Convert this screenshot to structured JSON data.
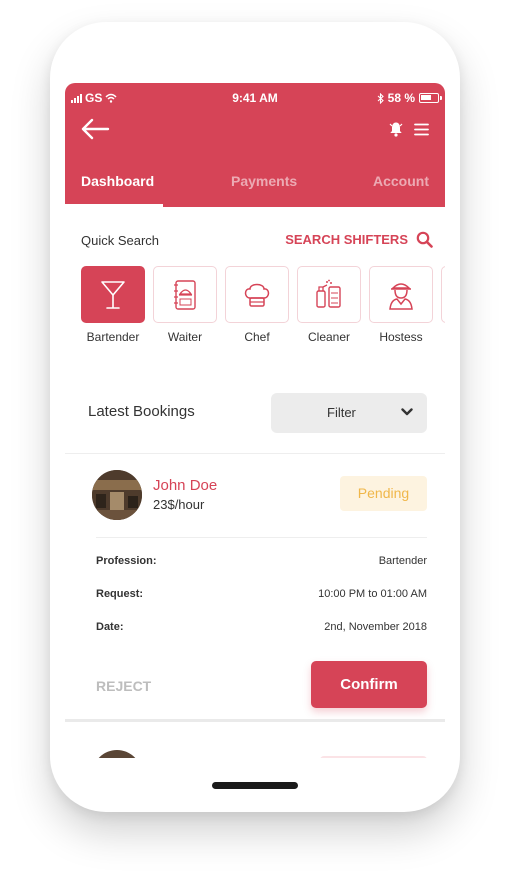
{
  "status_bar": {
    "carrier": "GS",
    "time": "9:41 AM",
    "battery": "58 %"
  },
  "header": {
    "tabs": [
      {
        "label": "Dashboard",
        "active": true
      },
      {
        "label": "Payments",
        "active": false
      },
      {
        "label": "Account",
        "active": false
      }
    ],
    "icons": [
      "back-arrow-icon",
      "bell-icon",
      "menu-icon"
    ]
  },
  "quick_search": {
    "label": "Quick Search",
    "link_label": "SEARCH SHIFTERS",
    "categories": [
      {
        "label": "Bartender",
        "icon": "cocktail-glass-icon",
        "active": true
      },
      {
        "label": "Waiter",
        "icon": "menu-book-icon",
        "active": false
      },
      {
        "label": "Chef",
        "icon": "chef-hat-icon",
        "active": false
      },
      {
        "label": "Cleaner",
        "icon": "cleaning-supplies-icon",
        "active": false
      },
      {
        "label": "Hostess",
        "icon": "hostess-icon",
        "active": false
      }
    ]
  },
  "bookings": {
    "label": "Latest Bookings",
    "filter_label": "Filter",
    "card": {
      "name": "John Doe",
      "rate": "23$/hour",
      "status": "Pending",
      "details": [
        {
          "key": "Profession:",
          "value": "Bartender"
        },
        {
          "key": "Request:",
          "value": "10:00 PM to 01:00 AM"
        },
        {
          "key": "Date:",
          "value": "2nd, November 2018"
        }
      ],
      "reject_label": "REJECT",
      "confirm_label": "Confirm"
    }
  },
  "colors": {
    "accent": "#d64457",
    "pending_text": "#f0b74a",
    "pending_bg": "#fdf3e0"
  }
}
